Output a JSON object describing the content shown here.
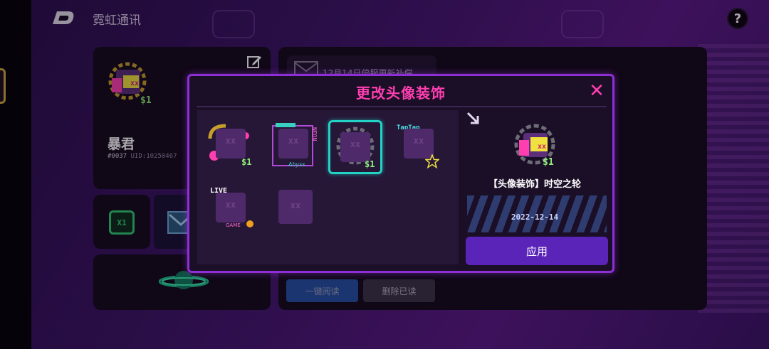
{
  "header": {
    "title": "霓虹通讯",
    "help_label": "?"
  },
  "profile": {
    "name": "暴君",
    "number": "#0037",
    "uid": "UID:10250467"
  },
  "mini_card": {
    "badge_text": "X1"
  },
  "messages": {
    "first_item": "12月14日停服更新补偿",
    "read_all_label": "一键阅读",
    "delete_read_label": "删除已读"
  },
  "modal": {
    "title": "更改头像装饰",
    "close_label": "✕",
    "decorations": [
      {
        "tag": "$1",
        "selected": false
      },
      {
        "tag": "",
        "selected": false
      },
      {
        "tag": "$1",
        "selected": true
      },
      {
        "tag": "",
        "selected": false
      },
      {
        "tag": "",
        "selected": false
      },
      {
        "tag": "",
        "selected": false
      }
    ],
    "decoration_texts": {
      "neon": "NEON",
      "abyss": "Abyss",
      "taptap": "TapTap",
      "live": "LIVE",
      "game": "GAME"
    },
    "detail": {
      "tag": "$1",
      "name": "【头像装饰】时空之轮",
      "date": "2022-12-14",
      "apply_label": "应用"
    }
  },
  "colors": {
    "accent_pink": "#ff3fb0",
    "modal_border": "#8e2fd6",
    "selected_border": "#22d3c5",
    "apply_button": "#5a24b8",
    "read_button": "#2f6fe0"
  }
}
